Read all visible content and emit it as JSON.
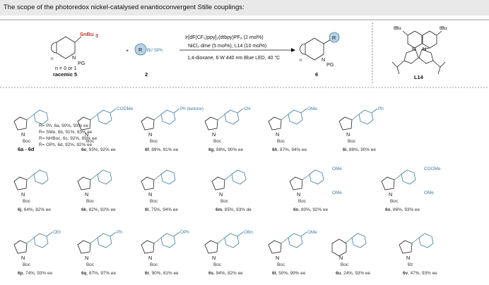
{
  "caption": "The scope of the photoredox nickel-catalysed enantioconvergent Stille couplings:",
  "scheme": {
    "reactant1_group": "SnBu",
    "reactant1_group_sub": "3",
    "reactant1_pg": "PG",
    "reactant1_n_label": "n = 0 or 1",
    "reactant1_name": "racemic 5",
    "plus": "+",
    "reactant2_r": "R",
    "reactant2_x": "Br/ SPh",
    "reactant2_num": "2",
    "cond1": "Ir[dF(CF₃)ppy]₂(dtbpy)PF₆ (2 mol%)",
    "cond2": "NiCl₂·dme (5 mol%), L14 (10 mol%)",
    "cond3": "1,4-dioxane, 6 W 440 nm Blue LED, 40 °C",
    "product_pg": "PG",
    "product_num": "6",
    "ligand_tbu": "tBu",
    "ligand_name": "L14"
  },
  "entries": [
    {
      "id": "6a-6d",
      "label": "6a - 6d",
      "sub": "R= Ph, 6a, 90%, 93% ee\nR= SMe, 6b, 91%, 93% ee\nR= NHBoc, 6c, 92%, 89% ee\nR= OPh, 6d, 92%, 92% ee"
    },
    {
      "id": "6e",
      "label": "6e",
      "text": ", 93%, 92% ee",
      "group": "COOMe"
    },
    {
      "id": "6f",
      "label": "6f",
      "text": ", 89%, 91% ee",
      "group": "Ph (ketone)"
    },
    {
      "id": "6g",
      "label": "6g",
      "text": ", 88%, 90% ee",
      "group": "CN"
    },
    {
      "id": "6h",
      "label": "6h",
      "text": ", 87%, 94% ee",
      "group": "OMe"
    },
    {
      "id": "6i",
      "label": "6i",
      "text": ", 88%, 90% ee",
      "group": "Ph"
    },
    {
      "id": "6j",
      "label": "6j",
      "text": ", 64%, 82% ee"
    },
    {
      "id": "6k",
      "label": "6k",
      "text": ", 82%, 92% ee"
    },
    {
      "id": "6l",
      "label": "6l",
      "text": ", 75%, 94% ee"
    },
    {
      "id": "6m",
      "label": "6m",
      "text": ", 85%, 93% de"
    },
    {
      "id": "6n",
      "label": "6n",
      "text": ", 80%, 92% ee",
      "group1": "OMe",
      "group2": "OMe"
    },
    {
      "id": "6o",
      "label": "6o",
      "text": ", 86%, 93% ee",
      "group1": "COOMe",
      "group2": "OMe"
    },
    {
      "id": "6p",
      "label": "6p",
      "text": ", 74%, 93% ee",
      "group": "OEt"
    },
    {
      "id": "6q",
      "label": "6q",
      "text": ", 87%, 97% ee",
      "group": "Ph"
    },
    {
      "id": "6r",
      "label": "6r",
      "text": ", 90%, 81% ee",
      "group": "OPh"
    },
    {
      "id": "6s",
      "label": "6s",
      "text": ", 94%, 82% ee",
      "group": "OBn"
    },
    {
      "id": "6t",
      "label": "6t",
      "text": ", 50%, 99% ee",
      "group": "OMe"
    },
    {
      "id": "6u",
      "label": "6u",
      "text": ", 24%, 93% ee",
      "group": "Boc"
    },
    {
      "id": "6v",
      "label": "6v",
      "text": ", 47%, 93% ee",
      "group": "Bz"
    }
  ],
  "atom_labels": {
    "N": "N",
    "Boc": "Boc",
    "Cl": "Cl",
    "O": "O",
    "S": "S",
    "R": "R",
    "Ph": "Ph",
    "n": "n",
    "N2": "N"
  }
}
